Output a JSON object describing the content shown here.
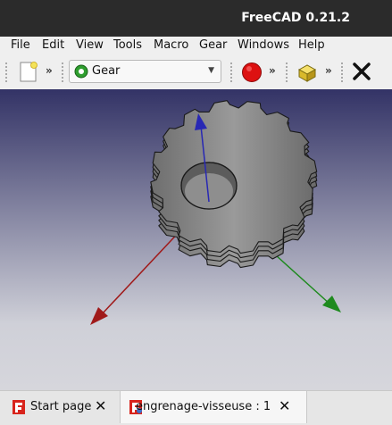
{
  "window": {
    "title": "FreeCAD 0.21.2"
  },
  "menu": [
    "File",
    "Edit",
    "View",
    "Tools",
    "Macro",
    "Gear",
    "Windows",
    "Help"
  ],
  "toolbar": {
    "workbench": "Gear",
    "more_1": "»",
    "more_2": "»",
    "more_3": "»",
    "workbench_icon": "gear-workbench-icon",
    "icons": [
      "new-document-icon",
      "record-macro-icon",
      "part-box-icon",
      "close-icon"
    ]
  },
  "tabs": [
    {
      "label": "Start page",
      "close": "✕"
    },
    {
      "label": "engrenage-visseuse : 1",
      "close": "✕"
    }
  ],
  "colors": {
    "titlebar": "#2b2b2b",
    "viewport_top": "#333366",
    "viewport_bottom": "#d6d6dc",
    "axis_x": "#a01a1a",
    "axis_y": "#1e8a1e",
    "axis_z": "#2828b4",
    "gear_face": "#c2c2c2"
  }
}
